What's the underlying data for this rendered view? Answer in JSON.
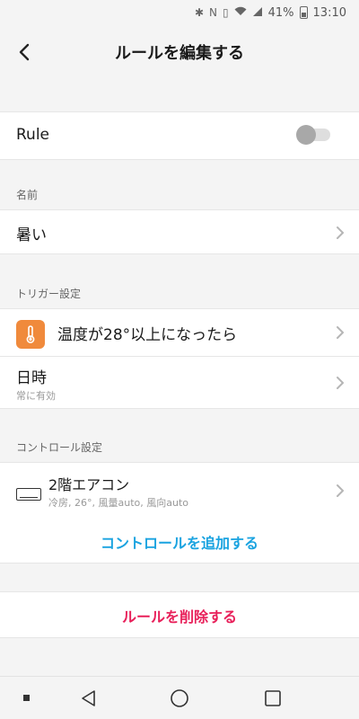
{
  "status_bar": {
    "battery_percent": "41%",
    "time": "13:10"
  },
  "header": {
    "title": "ルールを編集する"
  },
  "rule": {
    "label": "Rule",
    "enabled": false
  },
  "name_section": {
    "label": "名前",
    "value": "暑い"
  },
  "trigger_section": {
    "label": "トリガー設定",
    "items": [
      {
        "title": "温度が28°以上になったら",
        "icon": "thermometer-icon"
      },
      {
        "title": "日時",
        "subtitle": "常に有効"
      }
    ]
  },
  "control_section": {
    "label": "コントロール設定",
    "items": [
      {
        "title": "2階エアコン",
        "subtitle": "冷房, 26°, 風量auto, 風向auto",
        "icon": "air-conditioner-icon"
      }
    ],
    "add_label": "コントロールを追加する"
  },
  "delete_label": "ルールを削除する",
  "colors": {
    "accent_blue": "#1aa3e0",
    "delete_red": "#e8205a",
    "thermo_orange": "#f08a3c"
  }
}
